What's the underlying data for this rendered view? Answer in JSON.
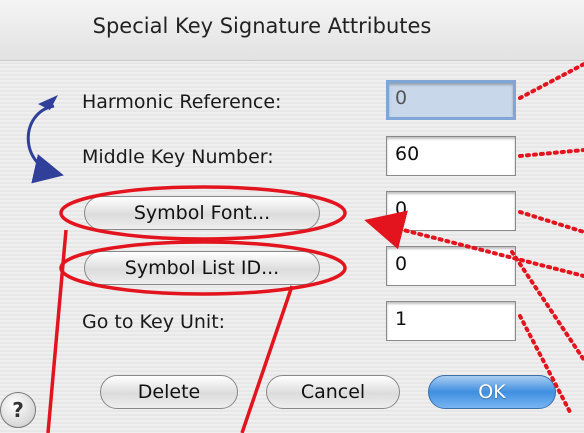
{
  "window": {
    "title": "Special Key Signature Attributes"
  },
  "fields": [
    {
      "label": "Harmonic Reference:",
      "value": "0"
    },
    {
      "label": "Middle Key Number:",
      "value": "60"
    },
    {
      "button": "Symbol Font...",
      "value": "0"
    },
    {
      "button": "Symbol List ID...",
      "value": "0"
    },
    {
      "label": "Go to Key Unit:",
      "value": "1"
    }
  ],
  "buttons": {
    "delete": "Delete",
    "cancel": "Cancel",
    "ok": "OK",
    "help": "?"
  },
  "colors": {
    "annotation": "#e3141e",
    "arrow": "#2f3f9a",
    "ok_blue": "#3f8fe0",
    "focus_blue": "#7fa6d6"
  }
}
